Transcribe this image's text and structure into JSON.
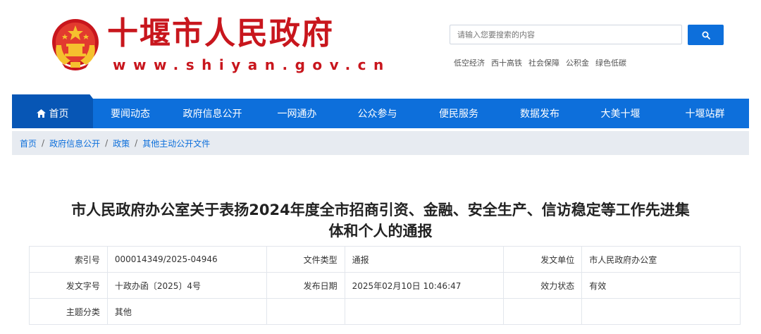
{
  "header": {
    "site_name": "十堰市人民政府",
    "site_url": "www.shiyan.gov.cn",
    "search": {
      "placeholder": "请输入您要搜索的内容"
    },
    "hotwords": [
      "低空经济",
      "西十高铁",
      "社会保障",
      "公积金",
      "绿色低碳"
    ]
  },
  "nav": {
    "items": [
      "首页",
      "要闻动态",
      "政府信息公开",
      "一网通办",
      "公众参与",
      "便民服务",
      "数据发布",
      "大美十堰",
      "十堰站群"
    ]
  },
  "breadcrumb": [
    "首页",
    "政府信息公开",
    "政策",
    "其他主动公开文件"
  ],
  "document": {
    "title_line1": "市人民政府办公室关于表扬2024年度全市招商引资、金融、安全生产、信访稳定等工作先进集",
    "title_line2": "体和个人的通报",
    "meta": [
      [
        {
          "k": "索引号",
          "v": "000014349/2025-04946"
        },
        {
          "k": "文件类型",
          "v": "通报"
        },
        {
          "k": "发文单位",
          "v": "市人民政府办公室"
        }
      ],
      [
        {
          "k": "发文字号",
          "v": "十政办函〔2025〕4号"
        },
        {
          "k": "发布日期",
          "v": "2025年02月10日 10:46:47"
        },
        {
          "k": "效力状态",
          "v": "有效"
        }
      ],
      [
        {
          "k": "主题分类",
          "v": "其他"
        },
        {
          "k": "",
          "v": ""
        },
        {
          "k": "",
          "v": ""
        }
      ]
    ]
  },
  "colors": {
    "brand_red": "#c8161d",
    "nav_blue": "#0d6fdb",
    "nav_active": "#0756b5",
    "breadcrumb_bg": "#e7ebf1"
  },
  "icons": {
    "search": "search-icon",
    "home": "home-icon",
    "emblem": "national-emblem-icon"
  }
}
